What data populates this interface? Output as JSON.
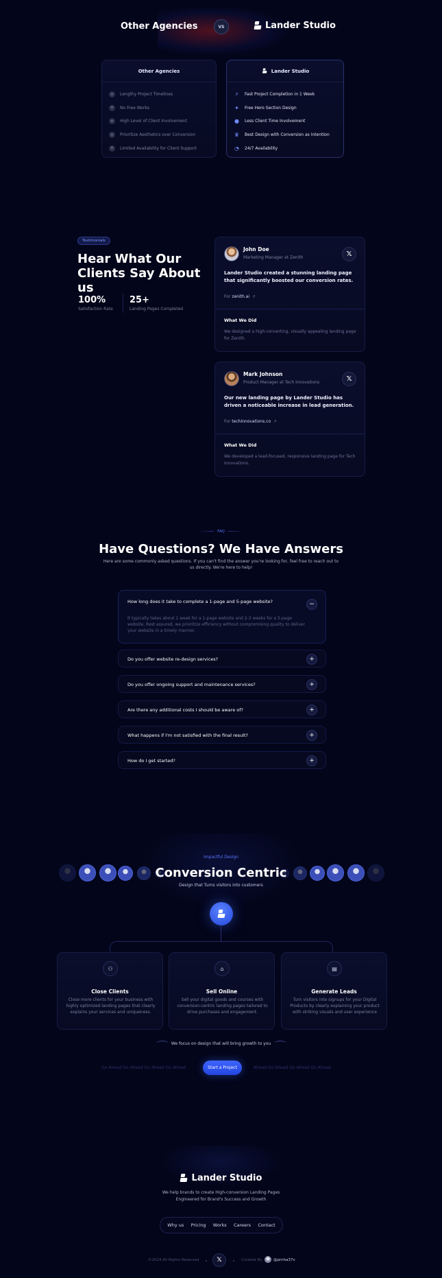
{
  "comparison": {
    "title_left": "Other Agencies",
    "vs": "VS",
    "title_right": "Lander Studio",
    "left_card": {
      "title": "Other Agencies",
      "items": [
        "Lengthy Project Timelines",
        "No Free Works",
        "High Level of Client Involvement",
        "Prioritize Aesthetics over Conversion",
        "Limited Availability for Client Support"
      ]
    },
    "right_card": {
      "title": "Lander Studio",
      "items": [
        {
          "icon": "lightning-icon",
          "glyph": "⚡",
          "label": "Fast Project Completion in 1 Week"
        },
        {
          "icon": "magic-wand-icon",
          "glyph": "✦",
          "label": "Free Hero Section Design"
        },
        {
          "icon": "user-circle-icon",
          "glyph": "●",
          "label": "Less Client Time Involvement"
        },
        {
          "icon": "crown-icon",
          "glyph": "♛",
          "label": "Best Design with Conversion as Intention"
        },
        {
          "icon": "clock-icon",
          "glyph": "◔",
          "label": "24/7 Availability"
        }
      ]
    }
  },
  "testimonials": {
    "badge": "Testimonials",
    "heading": "Hear What Our Clients Say About us",
    "stats": [
      {
        "value": "100%",
        "label": "Satisfaction Rate"
      },
      {
        "value": "25+",
        "label": "Landing Pages Completed"
      }
    ],
    "cards": [
      {
        "name": "John Doe",
        "role": "Marketing Manager at Zenith",
        "quote": "Lander Studio created a stunning landing page that significantly boosted our conversion rates.",
        "for_label": "For",
        "for_link": "zenith.ai",
        "did_title": "What We Did",
        "did_desc": "We designed a high-converting, visually appealing landing page for Zenith."
      },
      {
        "name": "Mark Johnson",
        "role": "Product Manager at Tech Innovations",
        "quote": "Our new landing page by Lander Studio has driven a noticeable increase in lead generation.",
        "for_label": "For",
        "for_link": "techinnovations.co",
        "did_title": "What We Did",
        "did_desc": "We developed a lead-focused, responsive landing page for Tech Innovations."
      }
    ]
  },
  "faq": {
    "tag": "FAQ",
    "title": "Have Questions? We Have Answers",
    "subtitle": "Here are some commonly asked questions. If you can't find the answer you're looking for, feel free to reach out to us directly. We're here to help!",
    "open": {
      "question": "How long does it take to complete a 1-page and 5-page website?",
      "answer": "It typically takes about 1 week for a 1-page website and 2-3 weeks for a 5-page website. Rest assured, we prioritize efficiency without compromising quality to deliver your website in a timely manner.",
      "toggle": "−"
    },
    "items": [
      {
        "question": "Do you offer website re-design services?",
        "toggle": "+"
      },
      {
        "question": "Do you offer ongoing support and maintenance services?",
        "toggle": "+"
      },
      {
        "question": "Are there any additional costs I should be aware of?",
        "toggle": "+"
      },
      {
        "question": "What happens if I'm not satisfied with the final result?",
        "toggle": "+"
      },
      {
        "question": "How do I get started?",
        "toggle": "+"
      }
    ]
  },
  "conversion": {
    "tag": "Impactful Design",
    "title": "Conversion Centric",
    "subtitle": "Design that Turns visitors into customers",
    "cards": [
      {
        "icon": "users-icon",
        "glyph": "⚇",
        "title": "Close Clients",
        "desc": "Close more clients for your business with highly optimized landing pages that clearly explains your services and uniqueness."
      },
      {
        "icon": "bag-icon",
        "glyph": "⌂",
        "title": "Sell Online",
        "desc": "Sell your digital goods and courses with conversion-centric landing pages tailored to drive purchases and engagement."
      },
      {
        "icon": "message-icon",
        "glyph": "▤",
        "title": "Generate Leads",
        "desc": "Turn visitors into signups for your Digital Products by clearly explaining your product with striking visuals and user experience"
      }
    ],
    "focus": "We focus on design that will bring growth to you",
    "ticker_left": "Go Ahead  Go Ahead  Go Ahead  Go Ahead",
    "ticker_right": "Ahead  Go Ahead  Go Ahead  Go Ahead",
    "cta": "Start a Project"
  },
  "footer": {
    "brand": "Lander Studio",
    "tagline_1": "We help brands to create High-conversion Landing Pages",
    "tagline_2": "Engineered for Brand's Success and Growth",
    "nav": [
      "Why us",
      "Pricing",
      "Works",
      "Careers",
      "Contact"
    ],
    "copyright": "©2024 All Rights Reserved",
    "created_by": "Created By",
    "creator": "@prnha37v"
  },
  "colors": {
    "background": "#03051a",
    "accent": "#3e64ff",
    "card_border": "#171d44"
  }
}
